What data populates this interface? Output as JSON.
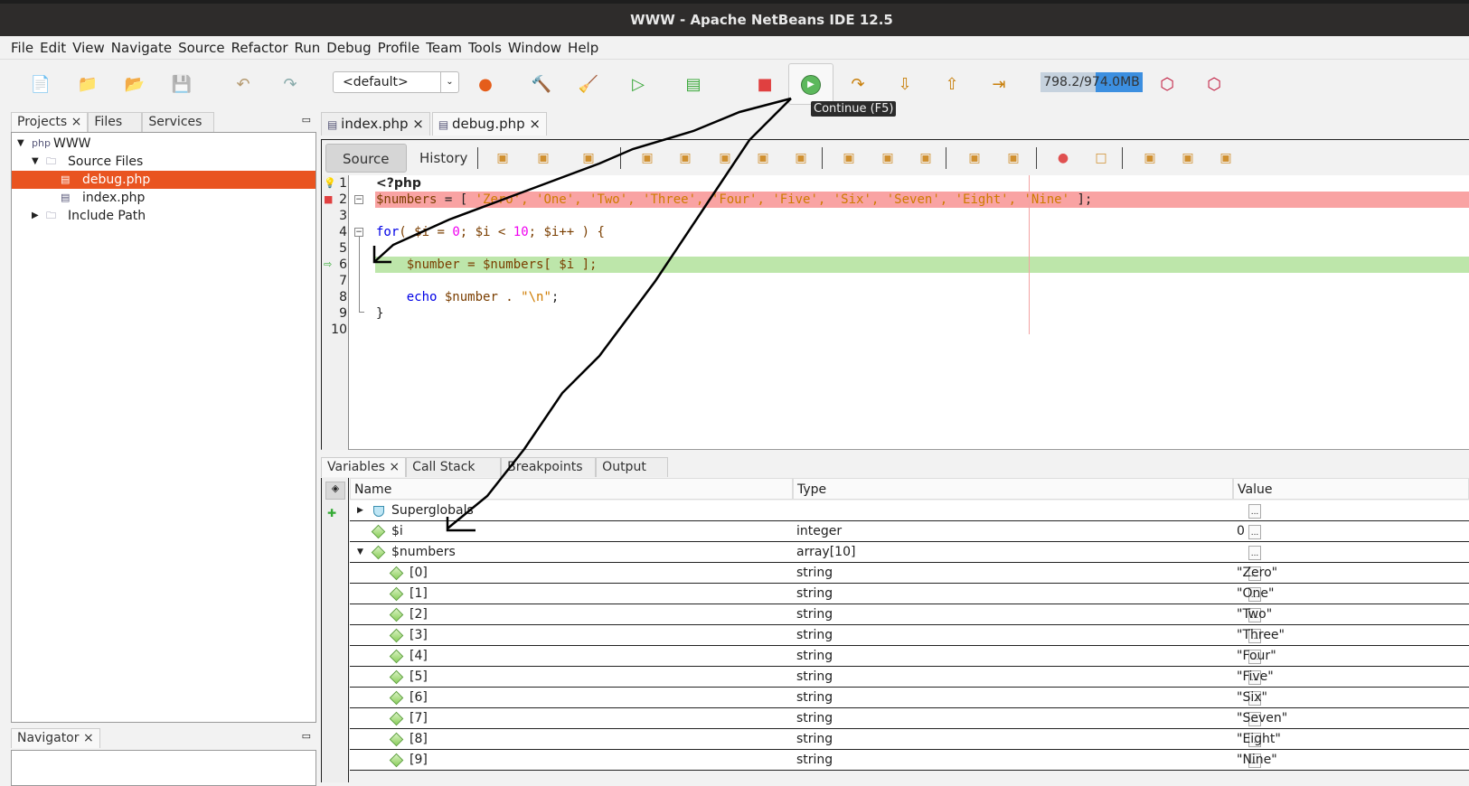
{
  "window": {
    "title": "WWW - Apache NetBeans IDE 12.5"
  },
  "menu": [
    "File",
    "Edit",
    "View",
    "Navigate",
    "Source",
    "Refactor",
    "Run",
    "Debug",
    "Profile",
    "Team",
    "Tools",
    "Window",
    "Help"
  ],
  "toolbar": {
    "config": "<default>",
    "memory": "798.2/974.0MB",
    "memory_used_fraction": 0.82,
    "tooltip": "Continue (F5)"
  },
  "left_panel": {
    "tabs": [
      "Projects",
      "Files",
      "Services"
    ],
    "tree": [
      {
        "label": "WWW",
        "level": 0,
        "icon": "php-project-icon",
        "expanded": true
      },
      {
        "label": "Source Files",
        "level": 1,
        "icon": "folder-icon",
        "expanded": true
      },
      {
        "label": "debug.php",
        "level": 2,
        "icon": "php-file-icon",
        "selected": true
      },
      {
        "label": "index.php",
        "level": 2,
        "icon": "php-file-icon"
      },
      {
        "label": "Include Path",
        "level": 1,
        "icon": "folder-icon",
        "expanded": false
      }
    ]
  },
  "navigator": {
    "title": "Navigator"
  },
  "editor": {
    "tabs": [
      "index.php",
      "debug.php"
    ],
    "active_tab": "debug.php",
    "source_label": "Source",
    "history_label": "History",
    "lines": [
      "1",
      "2",
      "3",
      "4",
      "5",
      "6",
      "7",
      "8",
      "9",
      "10"
    ],
    "code": {
      "l1": "<?php",
      "l2_var": "$numbers",
      "l2_rest": " = [ ",
      "l2_strings": "'Zero', 'One', 'Two', 'Three', 'Four', 'Five', 'Six', 'Seven', 'Eight', 'Nine'",
      "l2_end": " ];",
      "l4_kw": "for",
      "l4_a": "( $i = ",
      "l4_n0": "0",
      "l4_b": "; $i < ",
      "l4_n10": "10",
      "l4_c": "; $i++ ) {",
      "l6": "    $number = $numbers[ $i ];",
      "l8_kw": "    echo",
      "l8_var": " $number . ",
      "l8_str": "\"\\n\"",
      "l8_end": ";",
      "l9": "}"
    },
    "breakpoint_line": 2,
    "current_line": 6,
    "colors": {
      "breakpoint": "#f9a3a3",
      "current": "#bde6aa"
    }
  },
  "debug_panel": {
    "tabs": [
      "Variables",
      "Call Stack",
      "Breakpoints",
      "Output"
    ],
    "columns": [
      "Name",
      "Type",
      "Value"
    ],
    "rows": [
      {
        "name": "Superglobals",
        "type": "",
        "value": "",
        "level": 0,
        "expander": "collapsed",
        "icon": "superglobals-icon"
      },
      {
        "name": "$i",
        "type": "integer",
        "value": "0",
        "level": 0,
        "expander": "none",
        "icon": "variable-icon"
      },
      {
        "name": "$numbers",
        "type": "array[10]",
        "value": "",
        "level": 0,
        "expander": "expanded",
        "icon": "variable-icon"
      },
      {
        "name": "[0]",
        "type": "string",
        "value": "\"Zero\"",
        "level": 1
      },
      {
        "name": "[1]",
        "type": "string",
        "value": "\"One\"",
        "level": 1
      },
      {
        "name": "[2]",
        "type": "string",
        "value": "\"Two\"",
        "level": 1
      },
      {
        "name": "[3]",
        "type": "string",
        "value": "\"Three\"",
        "level": 1
      },
      {
        "name": "[4]",
        "type": "string",
        "value": "\"Four\"",
        "level": 1
      },
      {
        "name": "[5]",
        "type": "string",
        "value": "\"Five\"",
        "level": 1
      },
      {
        "name": "[6]",
        "type": "string",
        "value": "\"Six\"",
        "level": 1
      },
      {
        "name": "[7]",
        "type": "string",
        "value": "\"Seven\"",
        "level": 1
      },
      {
        "name": "[8]",
        "type": "string",
        "value": "\"Eight\"",
        "level": 1
      },
      {
        "name": "[9]",
        "type": "string",
        "value": "\"Nine\"",
        "level": 1
      }
    ]
  },
  "colors": {
    "selection": "#e95420",
    "accent": "#3c8fe0"
  }
}
